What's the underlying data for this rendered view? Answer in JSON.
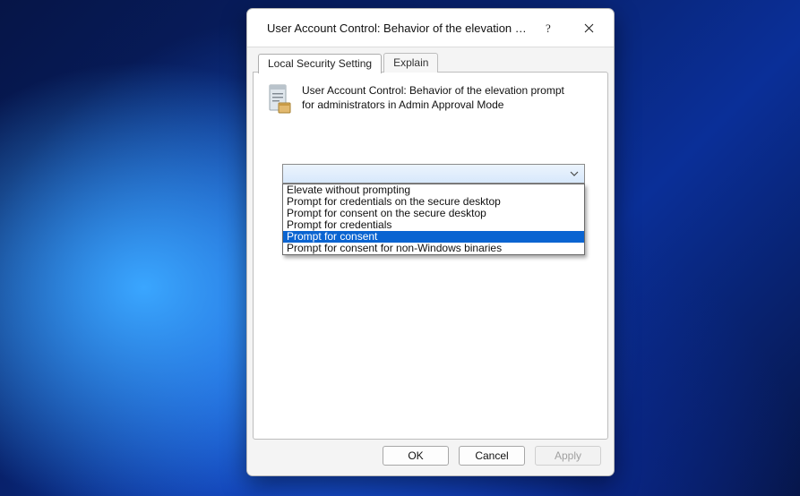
{
  "window": {
    "title": "User Account Control: Behavior of the elevation promp...",
    "help_tooltip": "Help",
    "close_tooltip": "Close"
  },
  "tabs": {
    "active": "Local Security Setting",
    "inactive": "Explain"
  },
  "policy": {
    "text": "User Account Control: Behavior of the elevation prompt for administrators in Admin Approval Mode"
  },
  "dropdown": {
    "selected_value": "",
    "options": [
      "Elevate without prompting",
      "Prompt for credentials on the secure desktop",
      "Prompt for consent on the secure desktop",
      "Prompt for credentials",
      "Prompt for consent",
      "Prompt for consent for non-Windows binaries"
    ],
    "highlighted_index": 4
  },
  "buttons": {
    "ok": "OK",
    "cancel": "Cancel",
    "apply": "Apply"
  }
}
